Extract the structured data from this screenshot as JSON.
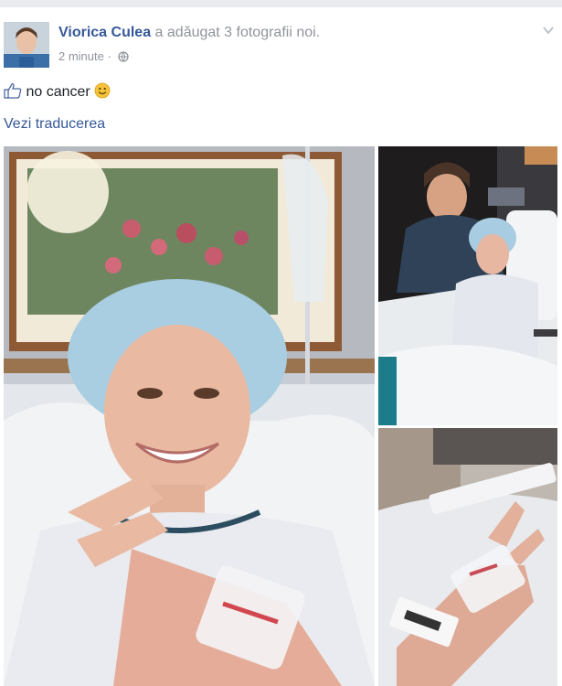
{
  "post": {
    "author": "Viorica Culea",
    "action": "a adăugat 3 fotografii noi.",
    "timestamp": "2 minute",
    "audience_icon": "globe-icon",
    "text": "no cancer",
    "like_icon": "thumbs-up-icon",
    "emoticon": "smiley-icon",
    "translate_link": "Vezi traducerea"
  },
  "colors": {
    "link": "#365899",
    "meta": "#90949c",
    "text": "#1d2129",
    "emoji": "#f5c33b"
  },
  "photos": [
    {
      "icon": "photo-selfie-hospital"
    },
    {
      "icon": "photo-hospital-bed-visitor"
    },
    {
      "icon": "photo-iv-hand"
    }
  ]
}
